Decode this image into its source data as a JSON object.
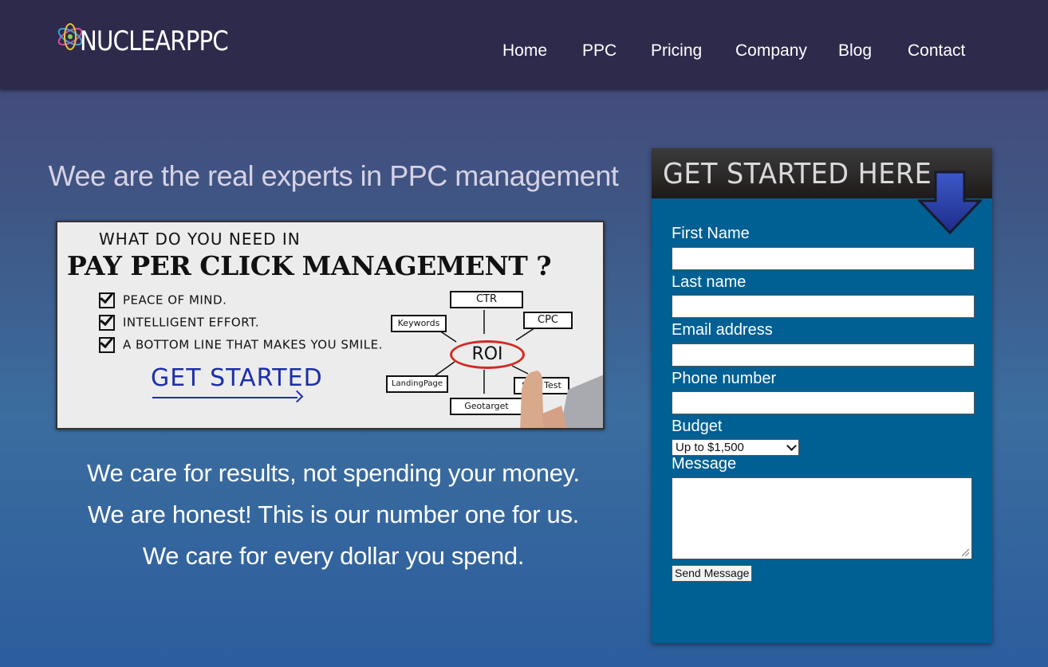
{
  "header": {
    "logo_text": "NUCLEARPPC",
    "nav": [
      "Home",
      "PPC",
      "Pricing",
      "Company",
      "Blog",
      "Contact"
    ]
  },
  "main": {
    "headline": "Wee are the real experts in PPC management",
    "hero": {
      "question_top": "WHAT DO YOU NEED IN",
      "question_main": "PAY PER CLICK MANAGEMENT ?",
      "checklist": [
        "PEACE OF MIND.",
        "INTELLIGENT EFFORT.",
        "A BOTTOM LINE THAT MAKES YOU SMILE."
      ],
      "cta": "GET STARTED",
      "diagram": {
        "center": "ROI",
        "nodes": [
          "CTR",
          "Keywords",
          "CPC",
          "LandingPage",
          "Split Test",
          "Geotarget"
        ]
      }
    },
    "taglines": [
      "We care for results, not spending your money.",
      "We are honest! This is our number one for us.",
      "We care for every dollar you spend."
    ]
  },
  "form": {
    "heading": "GET STARTED HERE",
    "first_name_label": "First Name",
    "last_name_label": "Last name",
    "email_label": "Email address",
    "phone_label": "Phone number",
    "budget_label": "Budget",
    "budget_selected": "Up to $1,500",
    "message_label": "Message",
    "submit_label": "Send Message"
  },
  "colors": {
    "header_bg": "#2e2a4c",
    "form_bg": "#005f93",
    "cta_blue": "#1d2fa7",
    "roi_red": "#d32a22"
  }
}
